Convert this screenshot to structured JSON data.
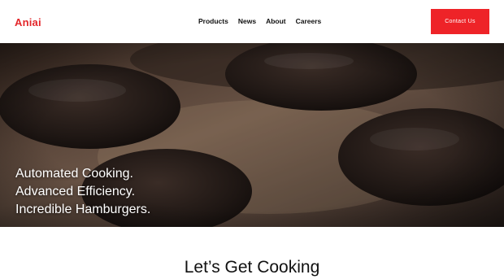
{
  "brand": {
    "logo_text": "Aniai",
    "accent": "#ee2328"
  },
  "nav": {
    "items": [
      {
        "label": "Products"
      },
      {
        "label": "News"
      },
      {
        "label": "About"
      },
      {
        "label": "Careers"
      }
    ],
    "contact_label": "Contact Us"
  },
  "hero": {
    "lines": [
      "Automated Cooking.",
      "Advanced Efficiency.",
      "Incredible Hamburgers."
    ]
  },
  "section": {
    "title": "Let’s Get Cooking"
  }
}
